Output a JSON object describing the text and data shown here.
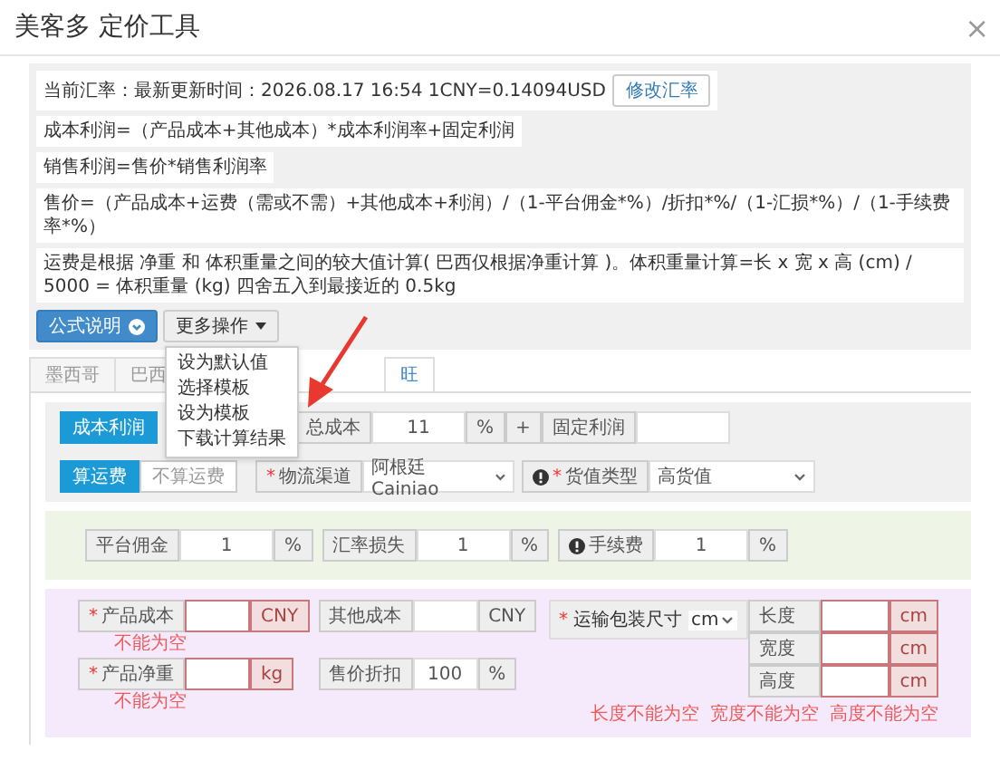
{
  "window": {
    "title": "美客多 定价工具",
    "close": "×"
  },
  "exchange": {
    "text": "当前汇率：最新更新时间：2026.08.17 16:54 1CNY=0.14094USD",
    "button": "修改汇率"
  },
  "formulas": [
    "成本利润=（产品成本+其他成本）*成本利润率+固定利润",
    "销售利润=售价*销售利润率",
    "售价=（产品成本+运费（需或不需）+其他成本+利润）/（1-平台佣金*%）/折扣*%/（1-汇损*%）/（1-手续费率*%）",
    "运费是根据 净重 和 体积重量之间的较大值计算( 巴西仅根据净重计算 )。体积重量计算=长 x 宽 x 高 (cm) / 5000 = 体积重量 (kg) 四舍五入到最接近的 0.5kg"
  ],
  "toolbar": {
    "help_button": "公式说明",
    "more_button": "更多操作"
  },
  "menu": {
    "items": [
      "设为默认值",
      "选择模板",
      "设为模板",
      "下载计算结果"
    ]
  },
  "tabs": [
    {
      "label": "墨西哥",
      "selected": false
    },
    {
      "label": "巴西",
      "selected": false
    },
    {
      "label": "旺",
      "selected": true
    }
  ],
  "profit_row": {
    "mode_button": {
      "label": "成本利润",
      "selected": true
    },
    "cost_label": "总成本",
    "rate_value": "11",
    "rate_unit": "%",
    "plus": "+",
    "fixed_label": "固定利润"
  },
  "shipping_row": {
    "options": [
      {
        "label": "算运费",
        "selected": true
      },
      {
        "label": "不算运费",
        "selected": false
      }
    ],
    "channel": {
      "label": "物流渠道",
      "marker": "*",
      "value": "阿根廷Cainiao"
    },
    "goods_type": {
      "label": "货值类型",
      "marker": "*",
      "value": "高货值"
    }
  },
  "fees": [
    {
      "label": "平台佣金",
      "value": "1",
      "unit": "%",
      "info": false
    },
    {
      "label": "汇率损失",
      "value": "1",
      "unit": "%",
      "info": false
    },
    {
      "label": "手续费",
      "value": "1",
      "unit": "%",
      "info": true
    }
  ],
  "costs": [
    {
      "label": "产品成本",
      "marker": "*",
      "unit": "CNY",
      "error": "不能为空"
    },
    {
      "label": "其他成本",
      "unit": "CNY"
    },
    {
      "label": "产品净重",
      "marker": "*",
      "unit": "kg",
      "error": "不能为空"
    },
    {
      "label": "售价折扣",
      "value": "100",
      "unit": "%"
    }
  ],
  "package": {
    "label": "运输包装尺寸",
    "marker": "*",
    "unit_select": "cm",
    "dims": [
      {
        "label": "长度",
        "unit": "cm",
        "invalid": true
      },
      {
        "label": "宽度",
        "unit": "cm",
        "invalid": true
      },
      {
        "label": "高度",
        "unit": "cm",
        "invalid": true
      }
    ],
    "errors": [
      "长度不能为空",
      "宽度不能为空",
      "高度不能为空"
    ]
  }
}
